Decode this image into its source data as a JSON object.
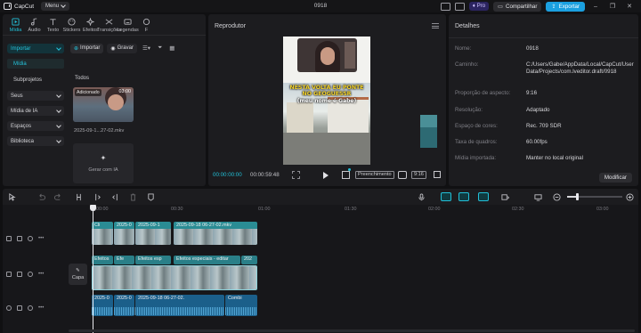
{
  "window": {
    "app_name": "CapCut",
    "menu_label": "Menu",
    "title": "0918",
    "pro_label": "Pro",
    "share_label": "Compartilhar",
    "export_label": "Exportar"
  },
  "media_tabs": [
    {
      "label": "Mídia",
      "icon": "media-icon",
      "active": true
    },
    {
      "label": "Áudio",
      "icon": "audio-icon"
    },
    {
      "label": "Texto",
      "icon": "text-icon"
    },
    {
      "label": "Stickers",
      "icon": "sticker-icon"
    },
    {
      "label": "Efeitos",
      "icon": "effects-icon"
    },
    {
      "label": "Transições",
      "icon": "transition-icon"
    },
    {
      "label": "Legendas",
      "icon": "captions-icon"
    },
    {
      "label": "F",
      "icon": "filter-icon"
    }
  ],
  "sidebar": {
    "importar": "Importar",
    "midia": "Mídia",
    "subprojetos": "Subprojetos",
    "seus": "Seus",
    "midia_ia": "Mídia de IA",
    "espacos": "Espaços",
    "biblioteca": "Biblioteca"
  },
  "media_toolbar": {
    "import_label": "Importar",
    "record_label": "Gravar"
  },
  "media": {
    "section": "Todos",
    "clip_tag": "Adicionado",
    "clip_duration": "03:00",
    "clip_name": "2025-09-1...27-02.mkv",
    "ai_label": "Gerar com IA"
  },
  "player": {
    "title": "Reprodutor",
    "caption": "NESTA VOLTA EU PONTE NO GEOGUESSR",
    "subcaption": "(meu nome é Gabe)",
    "time_current": "00:00:00:00",
    "time_total": "00:00:59:48",
    "fill_label": "Preenchimento",
    "ratio_label": "9:16"
  },
  "details": {
    "title": "Detalhes",
    "rows": [
      {
        "key": "Nome:",
        "value": "0918"
      },
      {
        "key": "Caminho:",
        "value": "C:/Users/Gabe/AppData/Local/CapCut/User Data/Projects/com.lveditor.draft/0918"
      },
      {
        "key": "Proporção de aspecto:",
        "value": "9:16"
      },
      {
        "key": "Resolução:",
        "value": "Adaptado"
      },
      {
        "key": "Espaço de cores:",
        "value": "Rec. 709 SDR"
      },
      {
        "key": "Taxa de quadros:",
        "value": "60.00fps"
      },
      {
        "key": "Mídia importada:",
        "value": "Manter no local original"
      }
    ],
    "modify_label": "Modificar"
  },
  "timeline": {
    "ruler": [
      "00:00",
      "00:30",
      "01:00",
      "01:30",
      "02:00",
      "02:30",
      "03:00"
    ],
    "cover_label": "Capa",
    "clips": {
      "top1": "Cli",
      "top2": "2025-0",
      "top3": "2025-09-1",
      "top4": "2025-09-18 06-27-02.mkv",
      "fx1": "Efeitos",
      "fx2": "Efe",
      "fx3": "Efeitos esp",
      "fx4": "Efeitos especiais - editar",
      "fx5": "202",
      "audio1": "2025-0",
      "audio2": "2025-0",
      "audio3": "2025-09-18 06-27-02.",
      "audio4": "Combi"
    }
  },
  "colors": {
    "accent": "#22c0d8",
    "export": "#1ba0e0",
    "panel": "#1c1c1f"
  }
}
